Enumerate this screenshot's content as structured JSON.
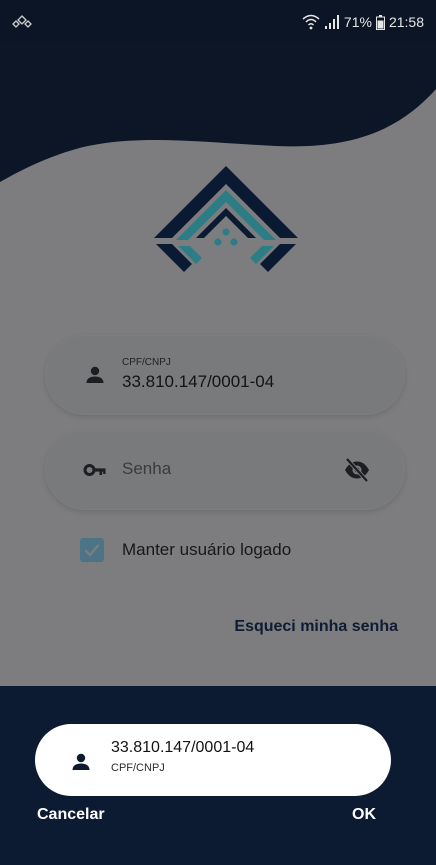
{
  "status_bar": {
    "left_icon": "app-notification-icon",
    "icons": [
      "wifi-icon",
      "signal-icon",
      "battery-icon"
    ],
    "battery": "71%",
    "time": "21:58"
  },
  "login": {
    "cpf_field": {
      "label": "CPF/CNPJ",
      "value": "33.810.147/0001-04",
      "icon": "person-icon"
    },
    "password_field": {
      "placeholder": "Senha",
      "icon": "key-icon",
      "toggle_icon": "visibility-off-icon"
    },
    "keep_logged": {
      "label": "Manter usuário logado",
      "checked": true
    },
    "forgot_password": "Esqueci minha senha"
  },
  "account_picker": {
    "account": {
      "value": "33.810.147/0001-04",
      "label": "CPF/CNPJ",
      "icon": "person-icon"
    },
    "cancel_label": "Cancelar",
    "ok_label": "OK"
  },
  "colors": {
    "navy": "#0c1a32",
    "teal": "#2d7d86",
    "checkbox": "#4d7387",
    "overlay_gray": "#7d7d7f"
  }
}
